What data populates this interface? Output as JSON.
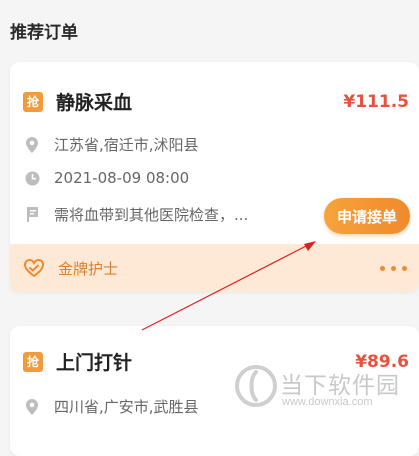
{
  "section": {
    "title": "推荐订单"
  },
  "orders": [
    {
      "tag": "抢",
      "title": "静脉采血",
      "price": "¥111.5",
      "location": "江苏省,宿迁市,沭阳县",
      "datetime": "2021-08-09  08:00",
      "note": "需将血带到其他医院检查，...",
      "action": "申请接单",
      "badge": "金牌护士"
    },
    {
      "tag": "抢",
      "title": "上门打针",
      "price": "¥89.6",
      "location": "四川省,广安市,武胜县"
    }
  ],
  "watermark": {
    "name": "当下软件园",
    "url": "www.downxia.com"
  },
  "colors": {
    "accent": "#f08a2c",
    "price": "#e8513e",
    "footer_bg": "#fde9d6",
    "annotation": "#e02020"
  }
}
